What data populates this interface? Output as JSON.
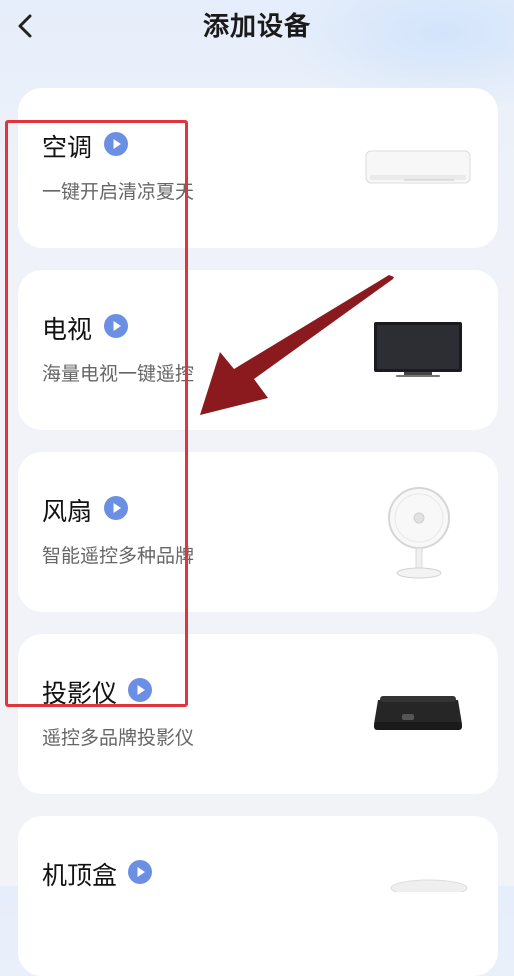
{
  "header": {
    "title": "添加设备"
  },
  "devices": [
    {
      "name": "空调",
      "desc": "一键开启清凉夏天"
    },
    {
      "name": "电视",
      "desc": "海量电视一键遥控"
    },
    {
      "name": "风扇",
      "desc": "智能遥控多种品牌"
    },
    {
      "name": "投影仪",
      "desc": "遥控多品牌投影仪"
    },
    {
      "name": "机顶盒",
      "desc": ""
    }
  ],
  "colors": {
    "accent": "#6b8fe3",
    "highlight": "#e0353d",
    "arrow": "#8b1a1f"
  },
  "icons": {
    "back": "chevron-left-icon",
    "play": "play-circle-icon",
    "air_conditioner": "air-conditioner-icon",
    "tv": "tv-icon",
    "fan": "fan-icon",
    "projector": "projector-icon"
  }
}
